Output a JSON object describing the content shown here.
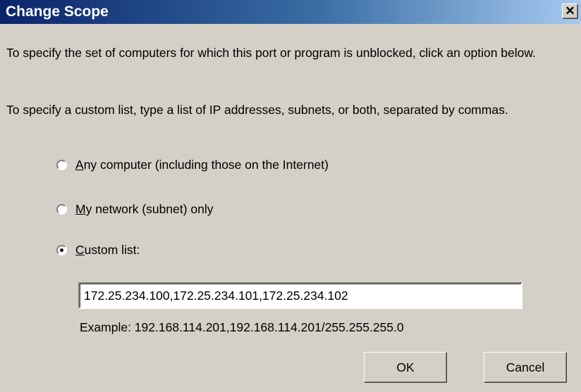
{
  "window": {
    "title": "Change Scope",
    "close_glyph": "✕"
  },
  "text": {
    "instruction_1": "To specify the set of computers for which this port or program is unblocked, click an option below.",
    "instruction_2": "To specify a custom list, type a list of IP addresses, subnets, or both, separated by commas."
  },
  "options": [
    {
      "accel": "A",
      "rest": "ny computer (including those on the Internet)",
      "selected": false
    },
    {
      "accel": "M",
      "rest": "y network (subnet) only",
      "selected": false
    },
    {
      "accel": "C",
      "rest": "ustom list:",
      "selected": true
    }
  ],
  "custom_list": {
    "value": "172.25.234.100,172.25.234.101,172.25.234.102"
  },
  "example_text": "Example: 192.168.114.201,192.168.114.201/255.255.255.0",
  "buttons": {
    "ok": "OK",
    "cancel": "Cancel"
  },
  "icons": {
    "close": "close-icon",
    "radio": "radio-button"
  },
  "colors": {
    "titlebar_start": "#0a246a",
    "titlebar_end": "#a6caf0",
    "dialog_bg": "#d4d0c8"
  }
}
